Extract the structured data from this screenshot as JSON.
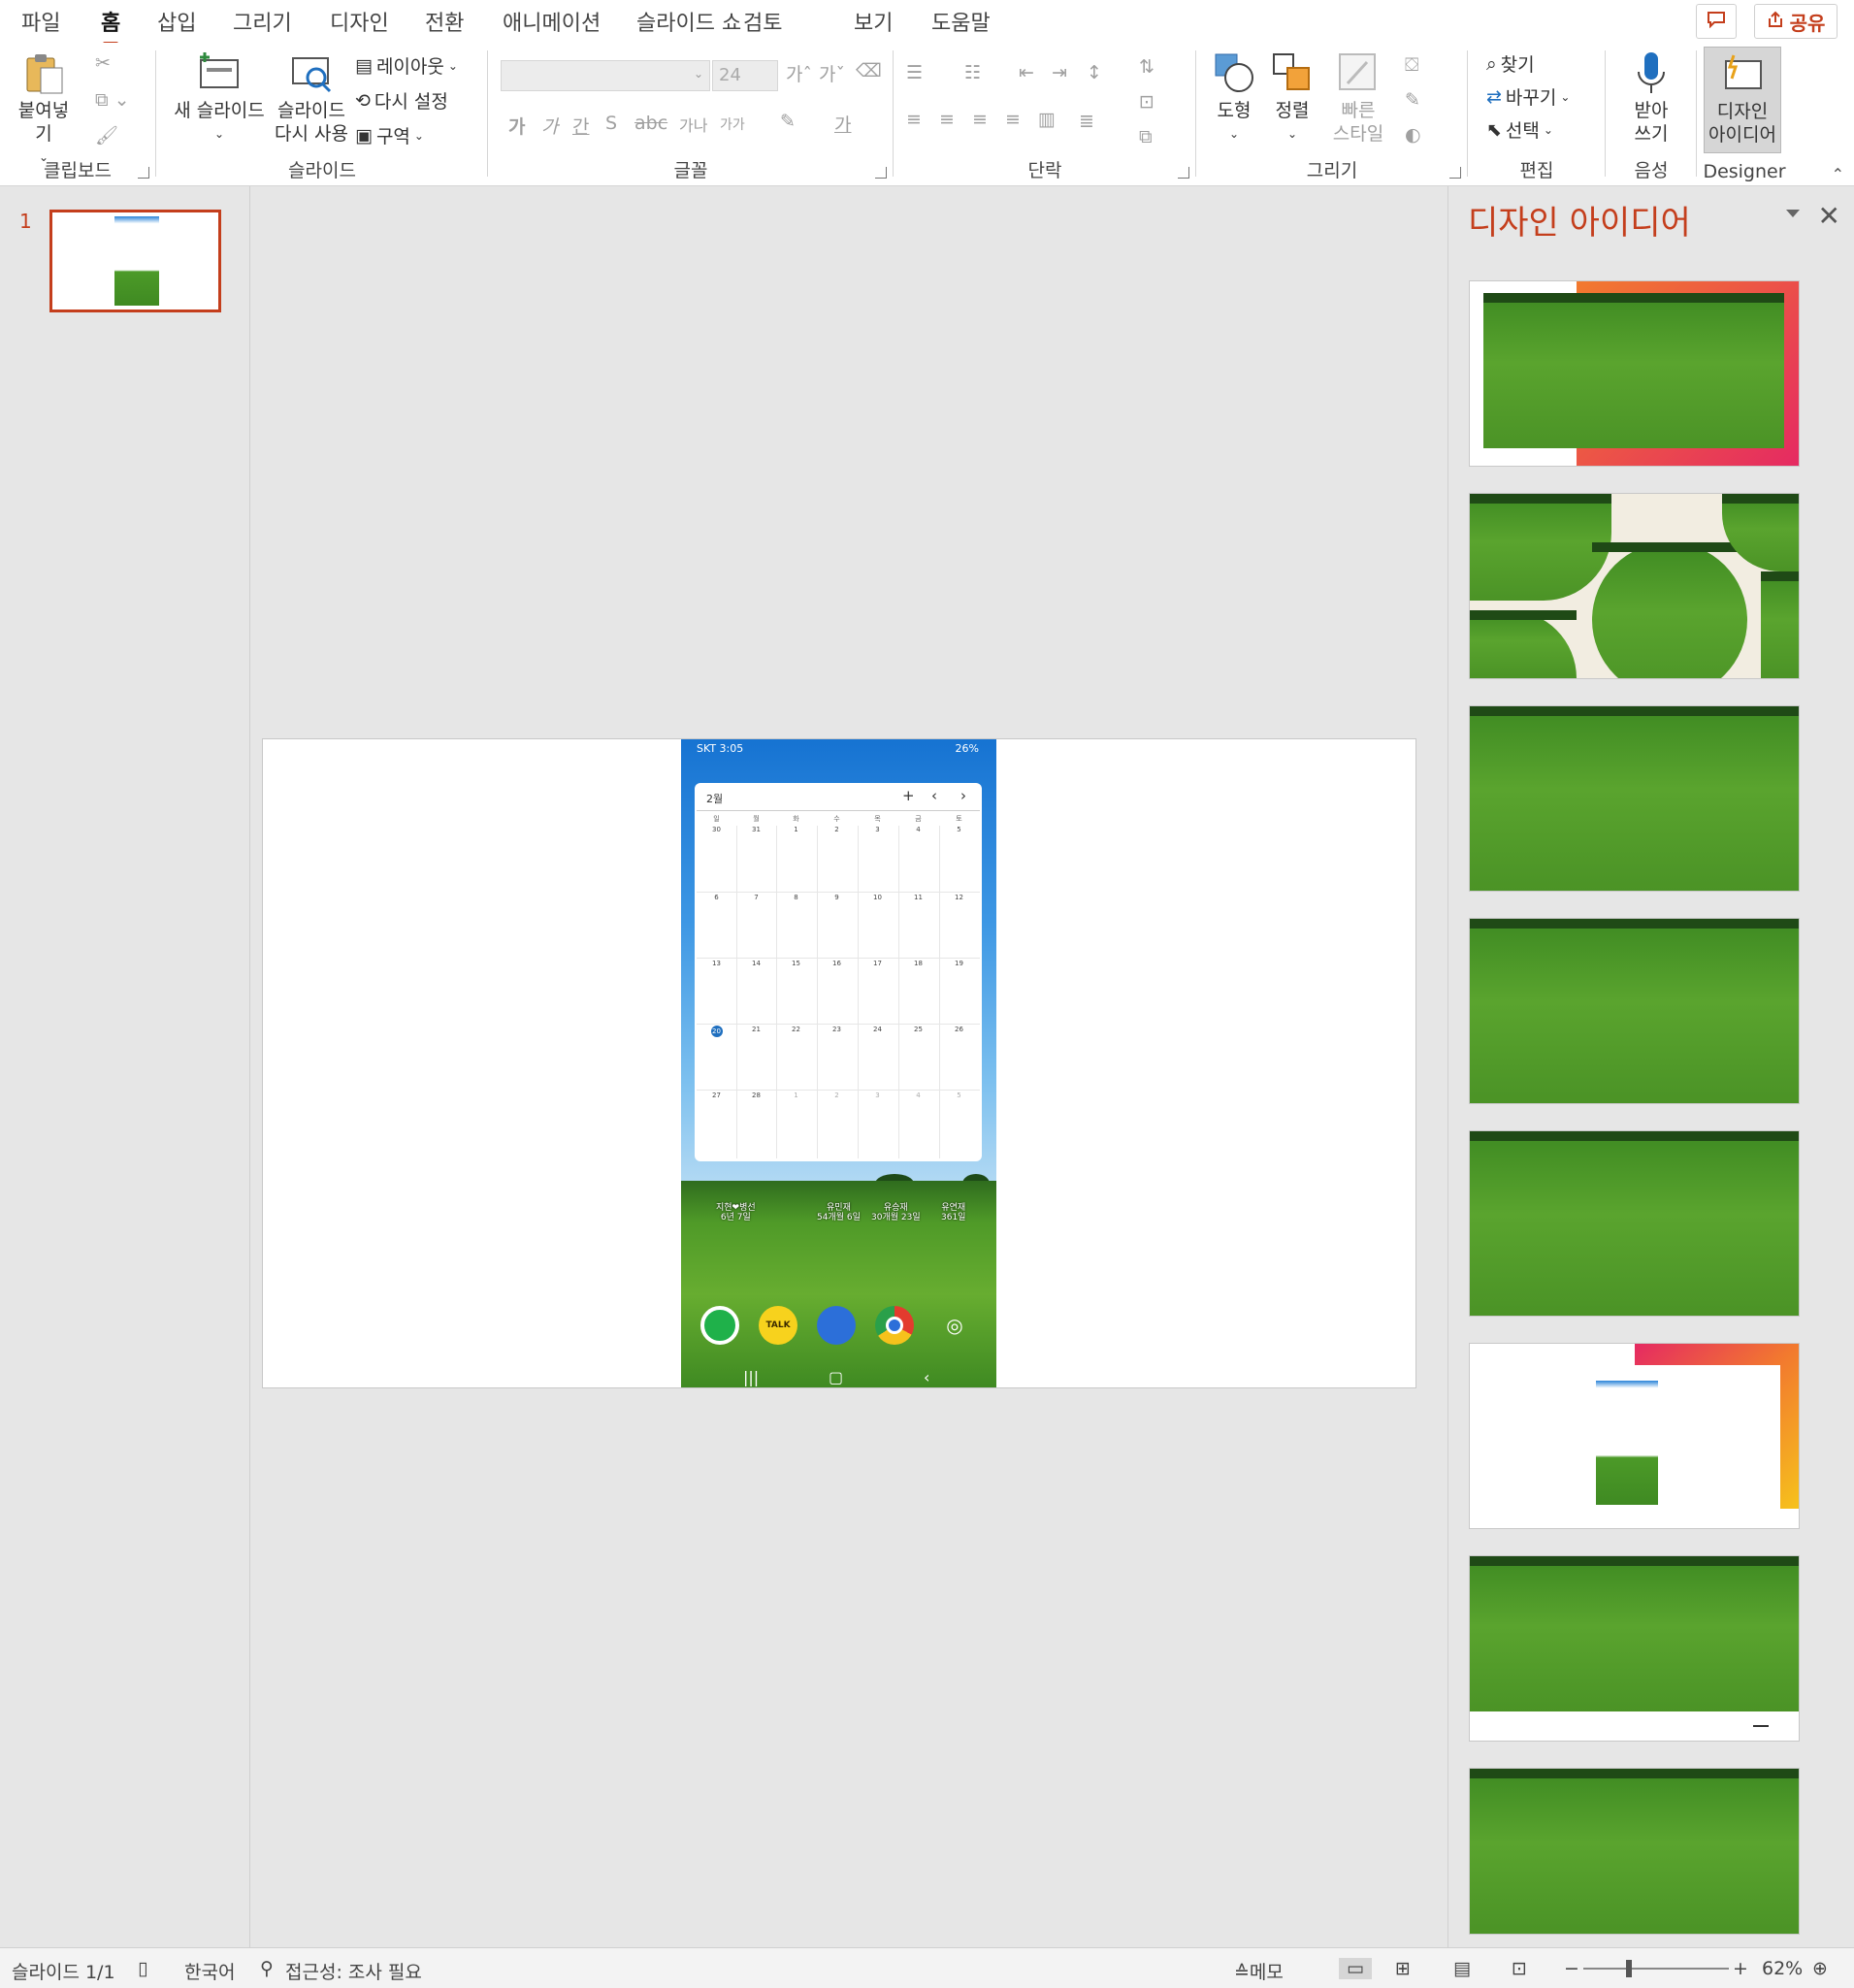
{
  "tabs": [
    "파일",
    "홈",
    "삽입",
    "그리기",
    "디자인",
    "전환",
    "애니메이션",
    "슬라이드 쇼",
    "검토",
    "보기",
    "도움말"
  ],
  "active_tab": "홈",
  "share_label": "공유",
  "ribbon": {
    "clipboard": {
      "paste": "붙여넣기",
      "label": "클립보드"
    },
    "slides": {
      "new_slide": "새 슬라이드",
      "reuse_line1": "슬라이드",
      "reuse_line2": "다시 사용",
      "layout": "레이아웃",
      "reset": "다시 설정",
      "section": "구역",
      "label": "슬라이드"
    },
    "font": {
      "size": "24",
      "label": "글꼴",
      "bold": "가",
      "italic": "가",
      "underline": "간",
      "strike": "S",
      "spacing": "가나",
      "case": "가가",
      "color": "가"
    },
    "paragraph": {
      "label": "단락"
    },
    "drawing": {
      "shape": "도형",
      "arrange": "정렬",
      "quick_line1": "빠른",
      "quick_line2": "스타일",
      "label": "그리기"
    },
    "editing": {
      "find": "찾기",
      "replace": "바꾸기",
      "select": "선택",
      "label": "편집"
    },
    "voice": {
      "dictate_line1": "받아",
      "dictate_line2": "쓰기",
      "label": "음성"
    },
    "designer": {
      "line1": "디자인",
      "line2": "아이디어",
      "label": "Designer"
    }
  },
  "thumbnails": {
    "number": "1"
  },
  "phone": {
    "status_left": "SKT 3:05",
    "status_right": "26%",
    "month": "2월",
    "weekdays": [
      "일",
      "월",
      "화",
      "수",
      "목",
      "금",
      "토"
    ],
    "weeks": [
      [
        "30",
        "31",
        "1",
        "2",
        "3",
        "4",
        "5"
      ],
      [
        "6",
        "7",
        "8",
        "9",
        "10",
        "11",
        "12"
      ],
      [
        "13",
        "14",
        "15",
        "16",
        "17",
        "18",
        "19"
      ],
      [
        "20",
        "21",
        "22",
        "23",
        "24",
        "25",
        "26"
      ],
      [
        "27",
        "28",
        "1",
        "2",
        "3",
        "4",
        "5"
      ]
    ],
    "widgets": [
      {
        "l1": "지현❤병선",
        "l2": "6년 7일"
      },
      {
        "l1": "유민재",
        "l2": "54개월 6일"
      },
      {
        "l1": "유승재",
        "l2": "30개월 23일"
      },
      {
        "l1": "유연재",
        "l2": "361일"
      }
    ],
    "talk": "TALK"
  },
  "designer_pane": {
    "title": "디자인 아이디어"
  },
  "status_bar": {
    "slide": "슬라이드 1/1",
    "language": "한국어",
    "accessibility": "접근성: 조사 필요",
    "notes": "메모",
    "zoom": "62%",
    "zoom_level": 0.62
  }
}
